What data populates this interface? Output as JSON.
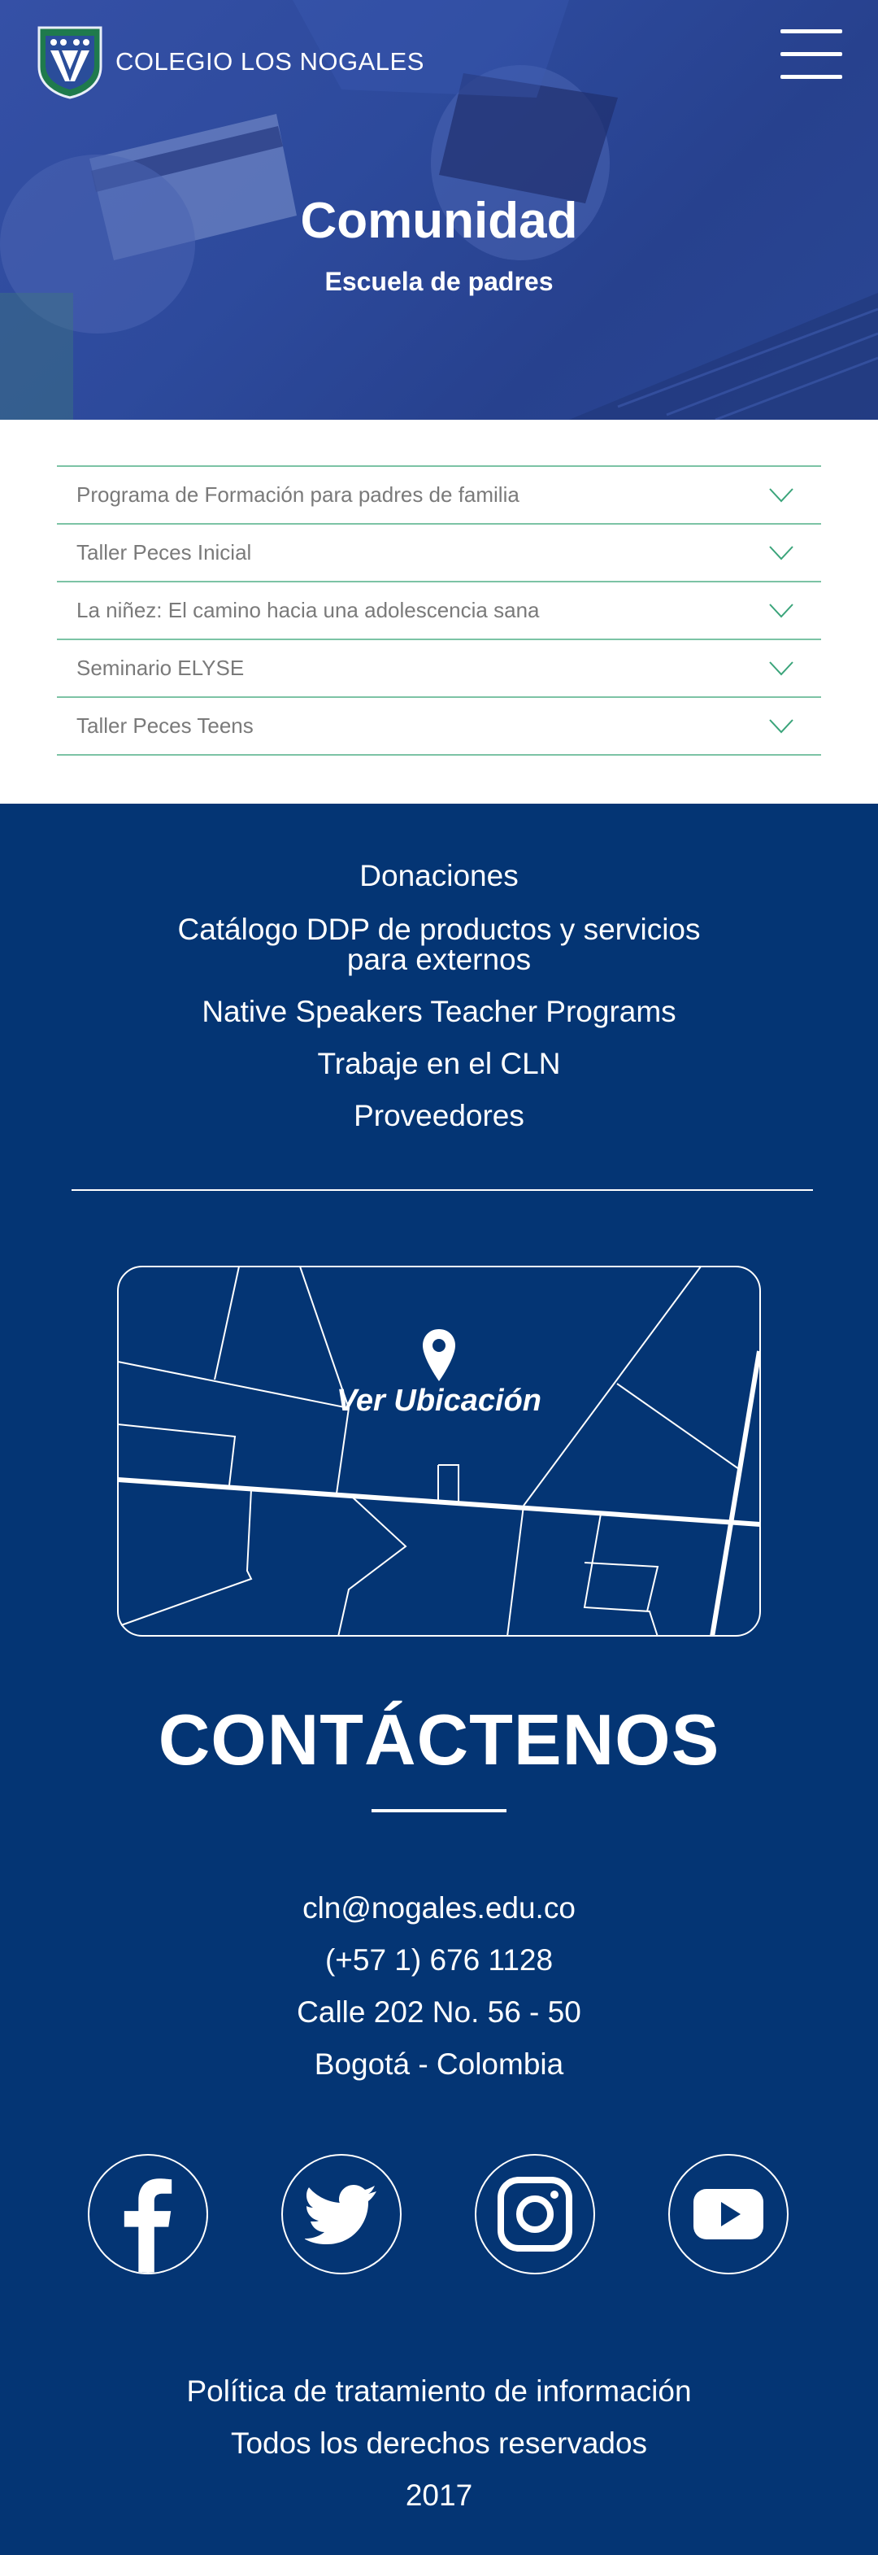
{
  "header": {
    "logo_text": "COLEGIO LOS NOGALES",
    "title": "Comunidad",
    "subtitle": "Escuela de padres"
  },
  "accordion": {
    "items": [
      {
        "label": "Programa de Formación para padres de familia"
      },
      {
        "label": "Taller Peces Inicial"
      },
      {
        "label": "La niñez: El camino hacia una adolescencia sana"
      },
      {
        "label": "Seminario ELYSE"
      },
      {
        "label": "Taller Peces Teens"
      }
    ]
  },
  "footer": {
    "links": [
      {
        "label": "Donaciones"
      },
      {
        "label": "Catálogo DDP de productos y servicios"
      },
      {
        "label": "para externos"
      },
      {
        "label": "Native Speakers Teacher Programs"
      },
      {
        "label": "Trabaje en el CLN"
      },
      {
        "label": "Proveedores"
      }
    ],
    "map_label": "Ver Ubicación",
    "contact_title": "CONTÁCTENOS",
    "contact": {
      "email": "cln@nogales.edu.co",
      "phone": "(+57 1) 676 1128",
      "address": "Calle 202 No. 56 - 50",
      "city": "Bogotá - Colombia"
    },
    "socials": [
      "facebook-icon",
      "twitter-icon",
      "instagram-icon",
      "youtube-icon"
    ],
    "legal": {
      "policy": "Política de tratamiento de información",
      "rights": "Todos los derechos reservados",
      "year": "2017"
    }
  },
  "colors": {
    "footer_bg": "#043574",
    "accent": "#7cc3a5",
    "logo_green": "#1f7a4d"
  }
}
